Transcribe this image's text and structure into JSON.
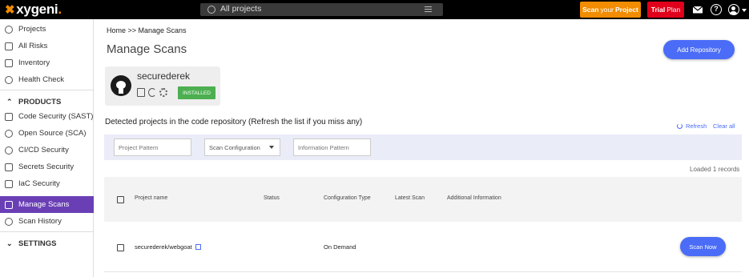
{
  "topbar": {
    "logo_text": "xygeni",
    "project_selector": "All projects",
    "scan_project": {
      "prefix": "Scan",
      "middle": "your",
      "suffix": "Project"
    },
    "trial": {
      "bold": "Trial",
      "rest": "Plan"
    },
    "icons": [
      "mail-icon",
      "help-icon",
      "user-icon"
    ],
    "help_glyph": "?"
  },
  "sidebar": {
    "items_top": [
      {
        "label": "Projects",
        "icon": "projects-icon"
      },
      {
        "label": "All Risks",
        "icon": "risks-icon"
      },
      {
        "label": "Inventory",
        "icon": "inventory-icon"
      },
      {
        "label": "Health Check",
        "icon": "health-check-icon"
      }
    ],
    "products_header": "PRODUCTS",
    "products": [
      {
        "label": "Code Security (SAST)",
        "icon": "code-security-icon"
      },
      {
        "label": "Open Source (SCA)",
        "icon": "open-source-icon"
      },
      {
        "label": "CI/CD Security",
        "icon": "cicd-icon"
      },
      {
        "label": "Secrets Security",
        "icon": "secrets-icon"
      },
      {
        "label": "IaC Security",
        "icon": "iac-icon"
      },
      {
        "label": "Manage Scans",
        "icon": "manage-scans-icon",
        "active": true
      },
      {
        "label": "Scan History",
        "icon": "scan-history-icon"
      }
    ],
    "settings_header": "SETTINGS",
    "chevron_up": "⌃",
    "chevron_down": "⌄"
  },
  "main": {
    "breadcrumb": "Home >> Manage Scans",
    "title": "Manage Scans",
    "add_repository": "Add Repository",
    "repo": {
      "name": "securederek",
      "status": "INSTALLED"
    },
    "detected_title": "Detected projects in the code repository (Refresh the list if you miss any)",
    "refresh": "Refresh",
    "clear_all": "Clear all",
    "filters": {
      "project_pattern": "Project Pattern",
      "scan_configuration": "Scan Configuration",
      "information_pattern": "Information Pattern"
    },
    "loaded": "Loaded 1 records",
    "columns": [
      "Project name",
      "Status",
      "Configuration Type",
      "Latest Scan",
      "Additional Information"
    ],
    "rows": [
      {
        "project": "securederek/webgoat",
        "status": "",
        "config": "On Demand",
        "latest": "",
        "info": "",
        "action": "Scan Now"
      }
    ]
  },
  "colors": {
    "accent": "#4a6cf7",
    "brand_orange": "#f28c00",
    "trial_red": "#e0001b",
    "active_nav": "#6a3fb5",
    "installed": "#4caf50"
  }
}
